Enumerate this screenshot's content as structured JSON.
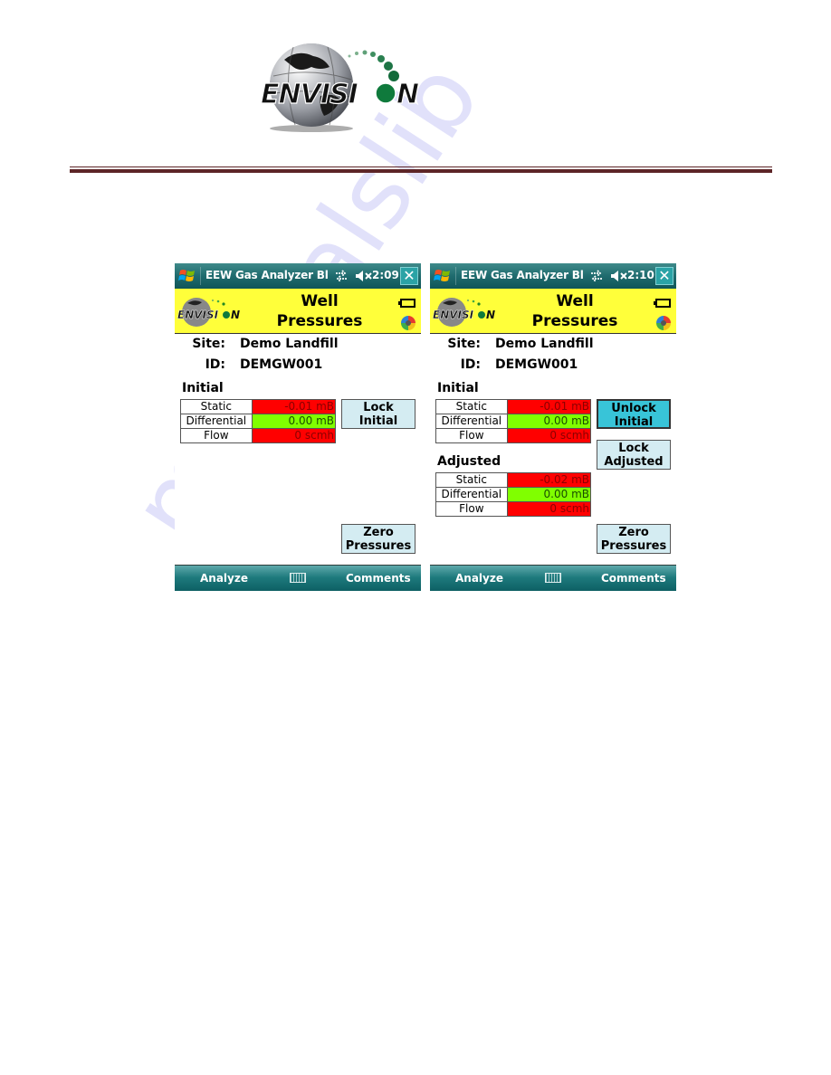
{
  "document": {
    "logo_text": "ENVISION",
    "rule_color": "#5d2527",
    "watermark": "manualslib"
  },
  "screens": [
    {
      "titlebar": {
        "title": "EEW Gas Analyzer Bl",
        "time": "2:09",
        "close_label": "✕"
      },
      "header": {
        "logo_text": "ENVISION",
        "title_line1": "Well",
        "title_line2": "Pressures"
      },
      "site": {
        "label": "Site:",
        "value": "Demo Landfill"
      },
      "id": {
        "label": "ID:",
        "value": "DEMGW001"
      },
      "initial": {
        "title": "Initial",
        "rows": [
          {
            "label": "Static",
            "value": "-0.01 mB",
            "status": "red"
          },
          {
            "label": "Differential",
            "value": "0.00 mB",
            "status": "green"
          },
          {
            "label": "Flow",
            "value": "0 scmh",
            "status": "red"
          }
        ]
      },
      "buttons": {
        "lock_initial": {
          "line1": "Lock",
          "line2": "Initial"
        },
        "zero_pressures": {
          "line1": "Zero",
          "line2": "Pressures"
        }
      },
      "bottombar": {
        "left": "Analyze",
        "right": "Comments"
      }
    },
    {
      "titlebar": {
        "title": "EEW Gas Analyzer Bl",
        "time": "2:10",
        "close_label": "✕"
      },
      "header": {
        "logo_text": "ENVISION",
        "title_line1": "Well",
        "title_line2": "Pressures"
      },
      "site": {
        "label": "Site:",
        "value": "Demo Landfill"
      },
      "id": {
        "label": "ID:",
        "value": "DEMGW001"
      },
      "initial": {
        "title": "Initial",
        "rows": [
          {
            "label": "Static",
            "value": "-0.01 mB",
            "status": "red"
          },
          {
            "label": "Differential",
            "value": "0.00 mB",
            "status": "green"
          },
          {
            "label": "Flow",
            "value": "0 scmh",
            "status": "red"
          }
        ]
      },
      "adjusted": {
        "title": "Adjusted",
        "rows": [
          {
            "label": "Static",
            "value": "-0.02 mB",
            "status": "red"
          },
          {
            "label": "Differential",
            "value": "0.00 mB",
            "status": "green"
          },
          {
            "label": "Flow",
            "value": "0 scmh",
            "status": "red"
          }
        ]
      },
      "buttons": {
        "unlock_initial": {
          "line1": "Unlock",
          "line2": "Initial"
        },
        "lock_adjusted": {
          "line1": "Lock",
          "line2": "Adjusted"
        },
        "zero_pressures": {
          "line1": "Zero",
          "line2": "Pressures"
        }
      },
      "bottombar": {
        "left": "Analyze",
        "right": "Comments"
      }
    }
  ],
  "colors": {
    "status_red": "#ff0000",
    "status_red_text": "#8b0000",
    "status_green": "#80ff00",
    "status_green_text": "#1a4d00",
    "header_yellow": "#ffff3a",
    "button_bg": "#d4ecf2",
    "button_active_bg": "#38c4d8"
  }
}
